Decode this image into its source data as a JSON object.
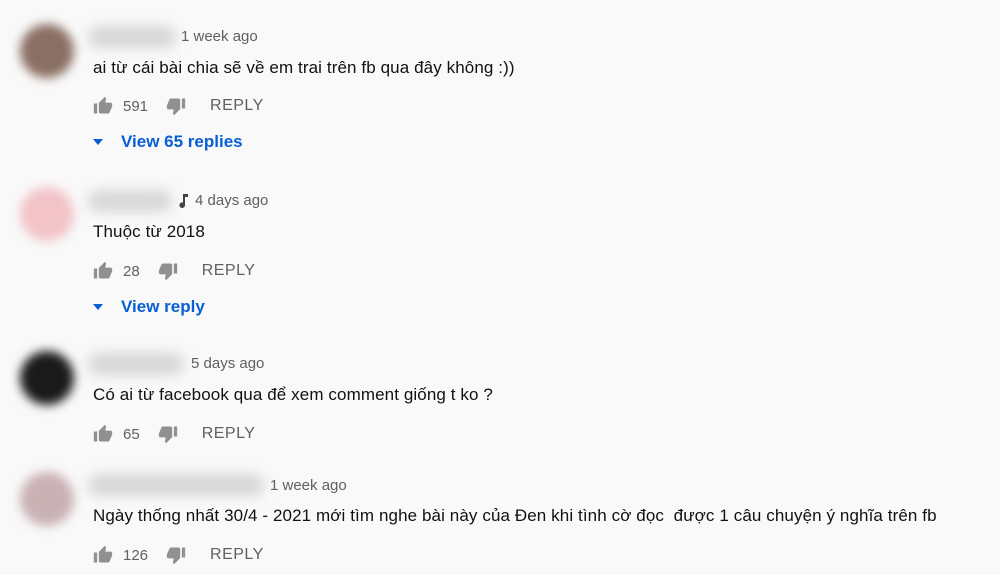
{
  "comments": [
    {
      "time": "1 week ago",
      "has_music_badge": false,
      "text": "ai từ cái bài chia sẽ về em trai trên fb qua đây không :))",
      "likes": "591",
      "reply_label": "REPLY",
      "replies_label": "View 65 replies",
      "avatar_color": "#8a6f63"
    },
    {
      "time": "4 days ago",
      "has_music_badge": true,
      "text": "Thuộc từ 2018",
      "likes": "28",
      "reply_label": "REPLY",
      "replies_label": "View reply",
      "avatar_color": "#f2c3c8"
    },
    {
      "time": "5 days ago",
      "has_music_badge": false,
      "text": "Có ai từ facebook qua để xem comment giống t ko ?",
      "likes": "65",
      "reply_label": "REPLY",
      "avatar_color": "#1a1a1a"
    },
    {
      "time": "1 week ago",
      "has_music_badge": false,
      "text": "Ngày thống nhất 30/4 - 2021 mới tìm nghe bài này của Đen khi tình cờ đọc  được 1 câu chuyện ý nghĩa trên fb",
      "likes": "126",
      "reply_label": "REPLY",
      "avatar_color": "#c9b1b4"
    }
  ],
  "colors": {
    "background": "#f9f9f9",
    "link_blue": "#065fd4",
    "meta_gray": "#606060"
  }
}
